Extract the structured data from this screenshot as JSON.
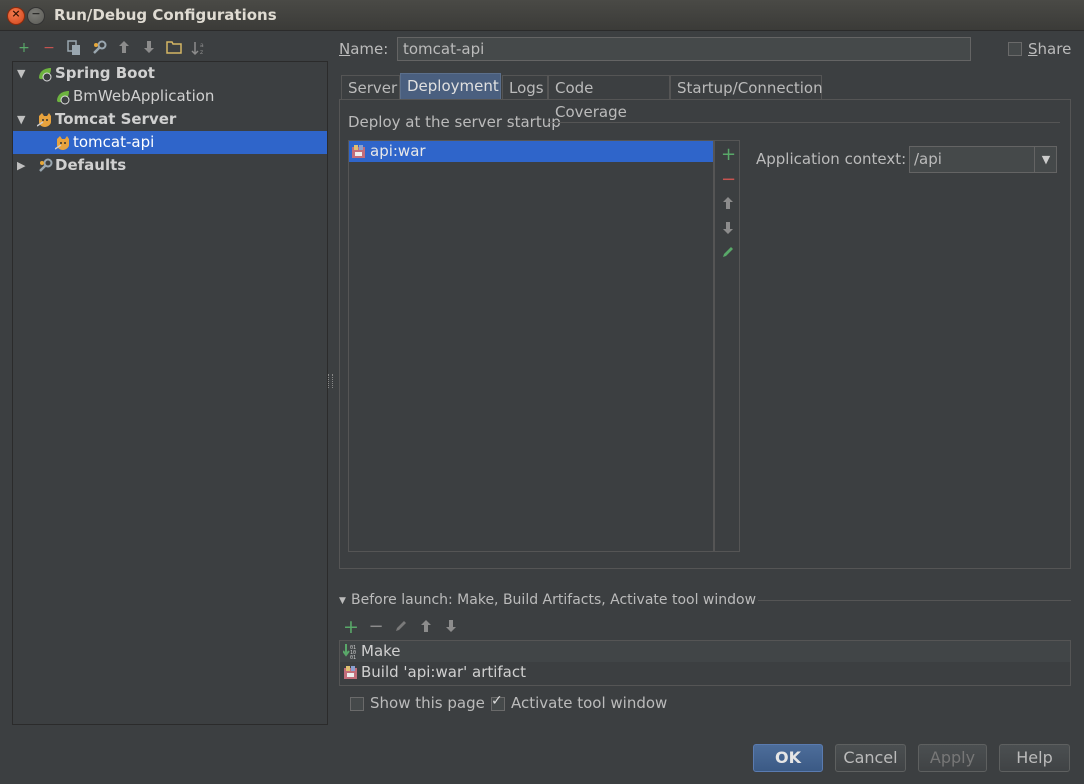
{
  "window": {
    "title": "Run/Debug Configurations"
  },
  "tree": {
    "items": [
      {
        "label": "Spring Boot",
        "bold": true
      },
      {
        "label": "BmWebApplication",
        "bold": false
      },
      {
        "label": "Tomcat Server",
        "bold": true
      },
      {
        "label": "tomcat-api",
        "bold": false,
        "selected": true
      },
      {
        "label": "Defaults",
        "bold": true
      }
    ]
  },
  "config": {
    "name_label": "Name:",
    "name_value": "tomcat-api",
    "share_label": "Share"
  },
  "tabs": [
    {
      "label": "Server"
    },
    {
      "label": "Deployment",
      "active": true
    },
    {
      "label": "Logs"
    },
    {
      "label": "Code Coverage"
    },
    {
      "label": "Startup/Connection"
    }
  ],
  "deployment": {
    "section_title": "Deploy at the server startup",
    "artifacts": [
      "api:war"
    ],
    "context_label": "Application context:",
    "context_value": "/api"
  },
  "before_launch": {
    "title": "Before launch: Make, Build Artifacts, Activate tool window",
    "tasks": [
      "Make",
      "Build 'api:war' artifact"
    ]
  },
  "options": {
    "show_page_label": "Show this page",
    "show_page_checked": false,
    "activate_label": "Activate tool window",
    "activate_checked": true
  },
  "buttons": {
    "ok": "OK",
    "cancel": "Cancel",
    "apply": "Apply",
    "help": "Help"
  },
  "colors": {
    "background": "#3c3f41",
    "selection": "#2f65ca",
    "add_green": "#59a869",
    "remove_red": "#c75450"
  }
}
